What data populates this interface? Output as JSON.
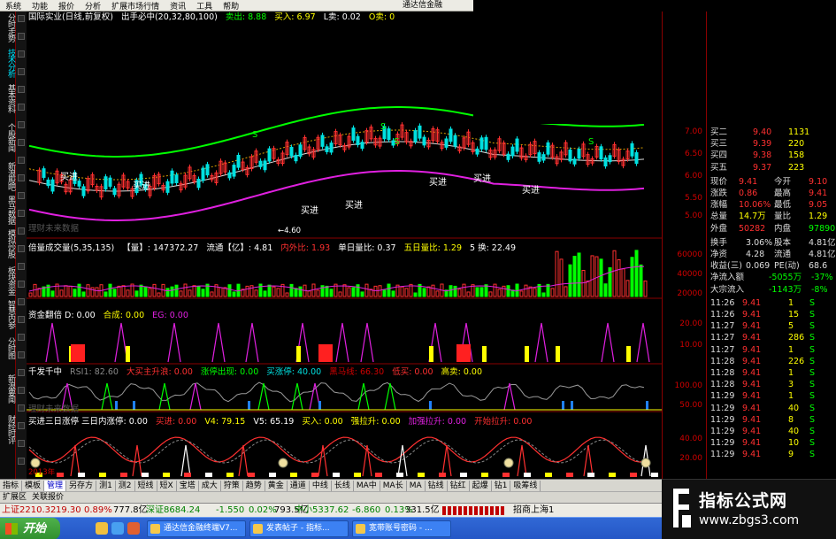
{
  "menu": {
    "items": [
      "系统",
      "功能",
      "报价",
      "分析",
      "扩展市场行情",
      "资讯",
      "工具",
      "帮助"
    ],
    "title": "通达信金融"
  },
  "left_tabs": [
    {
      "label": "分时走势",
      "hl": false
    },
    {
      "label": "技术分析",
      "hl": true
    },
    {
      "label": "基本资料",
      "hl": false
    },
    {
      "label": "个股新闻",
      "hl": false
    },
    {
      "label": "新浪股吧",
      "hl": false
    },
    {
      "label": "黑马数据",
      "hl": false
    },
    {
      "label": "模拟炒股",
      "hl": false
    },
    {
      "label": "板块资金",
      "hl": false
    },
    {
      "label": "智慧内参",
      "hl": false
    },
    {
      "label": "分时图",
      "hl": false
    },
    {
      "label": "新浪要闻",
      "hl": false
    },
    {
      "label": "财经时评",
      "hl": false
    }
  ],
  "main_pane": {
    "title": "国际实业(日线,前复权)",
    "indicator": "出手必中(20,32,80,100)",
    "sell": "卖出: 8.88",
    "buy": "买入: 6.97",
    "l": "L卖: 0.02",
    "o": "O卖: 0",
    "low_label": "4.60",
    "watermark": "理财未来数据",
    "signal": "买进",
    "s_mark": "S"
  },
  "vol_pane": {
    "title": "倍量成交量(5,35,135)",
    "vol": "【量】: 147372.27",
    "flow": "流通【亿】: 4.81",
    "inout": "内外比: 1.93",
    "day_ratio": "单日量比: 0.37",
    "five_ratio": "五日量比: 1.29",
    "turn": "5 换: 22.49"
  },
  "fund_pane": {
    "title": "资金翻倍 D: 0.00",
    "he": "合成: 0.00",
    "eg": "EG: 0.00"
  },
  "qf_pane": {
    "title": "千发千中",
    "rsi": "RSI1: 82.60",
    "big": "大买主升浪: 0.00",
    "zt": "涨停出现: 0.00",
    "buyz": "买涨停: 40.00",
    "hei": "黑马线: 66.30",
    "low": "低买: 0.00",
    "high": "高卖: 0.00",
    "watermark": "理财未来数据"
  },
  "zt_pane": {
    "title": "买进三日涨停 三日内涨停: 0.00",
    "mj": "买进: 0.00",
    "v4": "V4: 79.15",
    "v5": "V5: 65.19",
    "mr": "买入: 0.00",
    "qls": "强拉升: 0.00",
    "jq": "加强拉升: 0.00",
    "ks": "开始拉升: 0.00",
    "year": "2013年"
  },
  "axis": {
    "main": [
      "7.00",
      "6.50",
      "6.00",
      "5.50",
      "5.00"
    ],
    "vol": [
      "60000",
      "40000",
      "20000"
    ],
    "fund": [
      "20.00",
      "10.00"
    ],
    "qf": [
      "100.00",
      "50.00"
    ],
    "zt": [
      "40.00",
      "20.00"
    ],
    "bottom": "日线"
  },
  "quote": {
    "asks": [
      {
        "label": "买二",
        "price": "9.40",
        "vol": "1131"
      },
      {
        "label": "买三",
        "price": "9.39",
        "vol": "220"
      },
      {
        "label": "买四",
        "price": "9.38",
        "vol": "158"
      },
      {
        "label": "买五",
        "price": "9.37",
        "vol": "223"
      }
    ],
    "stats": [
      {
        "l1": "现价",
        "v1": "9.41",
        "l2": "今开",
        "v2": "9.10"
      },
      {
        "l1": "涨跌",
        "v1": "0.86",
        "l2": "最高",
        "v2": "9.41"
      },
      {
        "l1": "涨幅",
        "v1": "10.06%",
        "l2": "最低",
        "v2": "9.05"
      },
      {
        "l1": "总量",
        "v1": "14.7万",
        "l2": "量比",
        "v2": "1.29"
      },
      {
        "l1": "外盘",
        "v1": "50282",
        "l2": "内盘",
        "v2": "97890"
      }
    ],
    "stats2": [
      {
        "l1": "换手",
        "v1": "3.06%",
        "l2": "股本",
        "v2": "4.81亿"
      },
      {
        "l1": "净资",
        "v1": "4.28",
        "l2": "流通",
        "v2": "4.81亿"
      },
      {
        "l1": "收益(三)",
        "v1": "0.069",
        "l2": "PE(动)",
        "v2": "68.6"
      }
    ],
    "flows": [
      {
        "l": "净流入额",
        "v": "-5055万",
        "p": "-37%"
      },
      {
        "l": "大宗流入",
        "v": "-1143万",
        "p": "-8%"
      }
    ],
    "ticks": [
      {
        "t": "11:26",
        "p": "9.41",
        "v": "1",
        "s": "S"
      },
      {
        "t": "11:26",
        "p": "9.41",
        "v": "15",
        "s": "S"
      },
      {
        "t": "11:27",
        "p": "9.41",
        "v": "5",
        "s": "S"
      },
      {
        "t": "11:27",
        "p": "9.41",
        "v": "286",
        "s": "S"
      },
      {
        "t": "11:27",
        "p": "9.41",
        "v": "1",
        "s": "S"
      },
      {
        "t": "11:28",
        "p": "9.41",
        "v": "226",
        "s": "S"
      },
      {
        "t": "11:28",
        "p": "9.41",
        "v": "1",
        "s": "S"
      },
      {
        "t": "11:28",
        "p": "9.41",
        "v": "3",
        "s": "S"
      },
      {
        "t": "11:29",
        "p": "9.41",
        "v": "1",
        "s": "S"
      },
      {
        "t": "11:29",
        "p": "9.41",
        "v": "40",
        "s": "S"
      },
      {
        "t": "11:29",
        "p": "9.41",
        "v": "8",
        "s": "S"
      },
      {
        "t": "11:29",
        "p": "9.41",
        "v": "40",
        "s": "S"
      },
      {
        "t": "11:29",
        "p": "9.41",
        "v": "10",
        "s": "S"
      },
      {
        "t": "11:29",
        "p": "9.41",
        "v": "9",
        "s": "S"
      }
    ]
  },
  "tabs": [
    "指标",
    "模板",
    "管理",
    "另存方",
    "测1",
    "测2",
    "短线",
    "短X",
    "宝塔",
    "成大",
    "狩策",
    "趋势",
    "黄金",
    "通道",
    "中线",
    "长线",
    "MA中",
    "MA长",
    "MA",
    "钻线",
    "钻红",
    "起爆",
    "钻1",
    "吸筹线"
  ],
  "tabs2": [
    "扩展区",
    "关联报价"
  ],
  "ticker": {
    "sh": "上证2210.32",
    "sh_chg": "19.30",
    "sh_pct": "0.89%",
    "sh_amt": "777.8亿",
    "sz": "深证8684.24",
    "sz_chg": "-1.550",
    "sz_pct": "0.02%",
    "sz_amt": "793.5亿",
    "zx": "中小5337.62",
    "zx_chg": "-6.860",
    "zx_pct": "0.13%",
    "zx_amt": "331.5亿",
    "broker": "招商上海1"
  },
  "taskbar": {
    "start": "开始",
    "windows": [
      "通达信金融终端V7...",
      "发表帖子 - 指标...",
      "宽带账号密码 - ..."
    ]
  },
  "watermark": {
    "main": "指标公式网",
    "sub": "www.zbgs3.com"
  },
  "colors": {
    "up": "#ff3030",
    "down": "#00e0e0",
    "green": "#00ff00",
    "magenta": "#e020e0",
    "yellow": "#ffff00",
    "white": "#ffffff",
    "dim": "#cf0000"
  }
}
